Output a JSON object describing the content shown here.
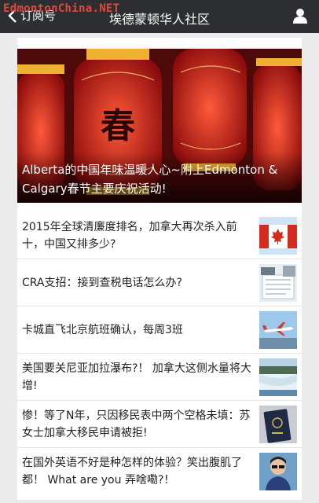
{
  "header": {
    "watermark": "EdmontonChina.NET",
    "back_label": "订阅号",
    "title": "埃德蒙顿华人社区"
  },
  "hero": {
    "title": "Alberta的中国年味温暖人心~附上Edmonton & Calgary春节主要庆祝活动!",
    "image_text": "春"
  },
  "articles": [
    {
      "title": "2015年全球清廉度排名，加拿大再次杀入前十，中国又排多少?",
      "thumb": "canada-flag"
    },
    {
      "title": "CRA支招：接到查税电话怎么办?",
      "thumb": "tax-documents"
    },
    {
      "title": "卡城直飞北京航班确认，每周3班",
      "thumb": "airplane"
    },
    {
      "title": "美国要关尼亚加拉瀑布?！ 加拿大这侧水量将大增!",
      "thumb": "niagara-falls"
    },
    {
      "title": "惨！等了N年，只因移民表中两个空格未填：苏女士加拿大移民申请被拒!",
      "thumb": "passport"
    },
    {
      "title": "在国外英语不好是种怎样的体验？笑出腹肌了都！ What are you 弄啥嘞?！",
      "thumb": "person-photo"
    }
  ],
  "colors": {
    "topbar": "#2d2e32",
    "watermark": "#e0483d",
    "background": "#ebebeb"
  }
}
